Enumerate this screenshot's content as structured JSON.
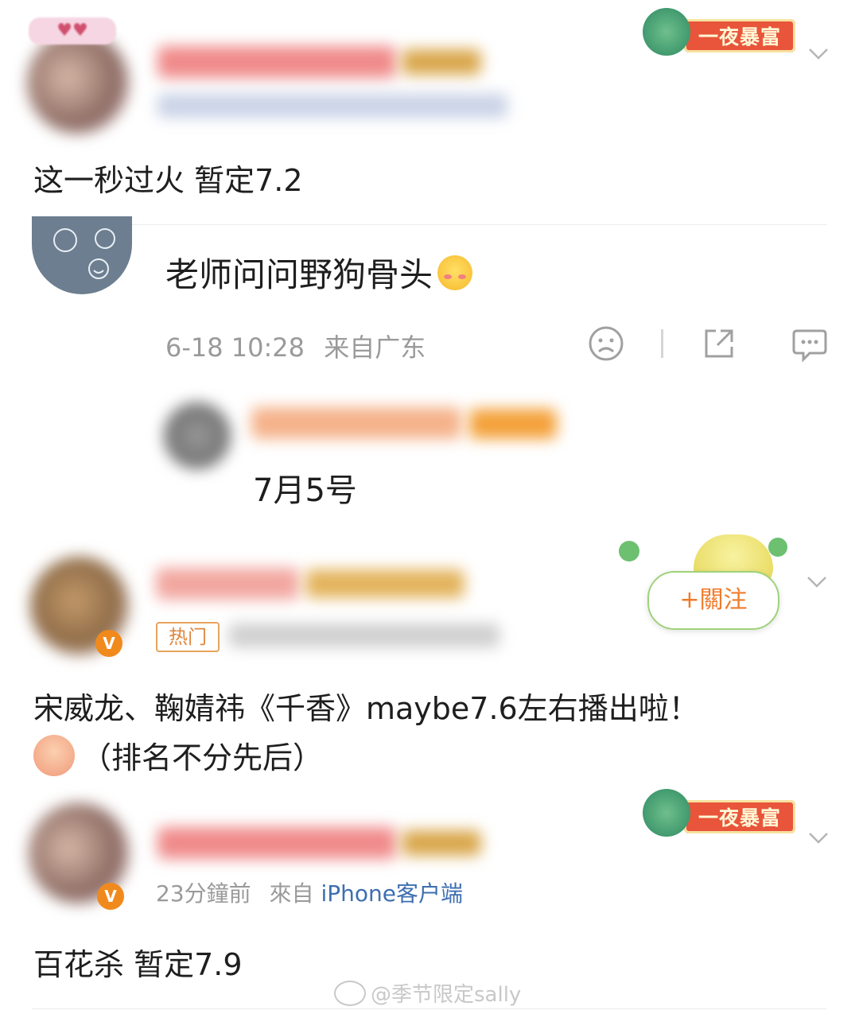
{
  "comments": [
    {
      "text": "这一秒过火 暂定7.2",
      "badge": "一夜暴富"
    },
    {
      "text": "老师问问野狗骨头",
      "time": "6-18 10:28",
      "location": "来自广东",
      "reply_text": "7月5号"
    },
    {
      "hot_label": "热门",
      "follow_label": "+關注",
      "text_line1": "宋威龙、鞠婧祎《千香》maybe7.6左右播出啦！",
      "text_line2": "（排名不分先后）"
    },
    {
      "badge": "一夜暴富",
      "time": "23分鐘前",
      "source_prefix": "來自",
      "source_app": "iPhone客户端",
      "text": "百花杀 暂定7.9"
    }
  ],
  "watermark": "@季节限定sally",
  "colors": {
    "meta_gray": "#9a9a9a",
    "link_blue": "#3d6fb0",
    "badge_red": "#e8553b",
    "vip_orange": "#f08a1c"
  }
}
